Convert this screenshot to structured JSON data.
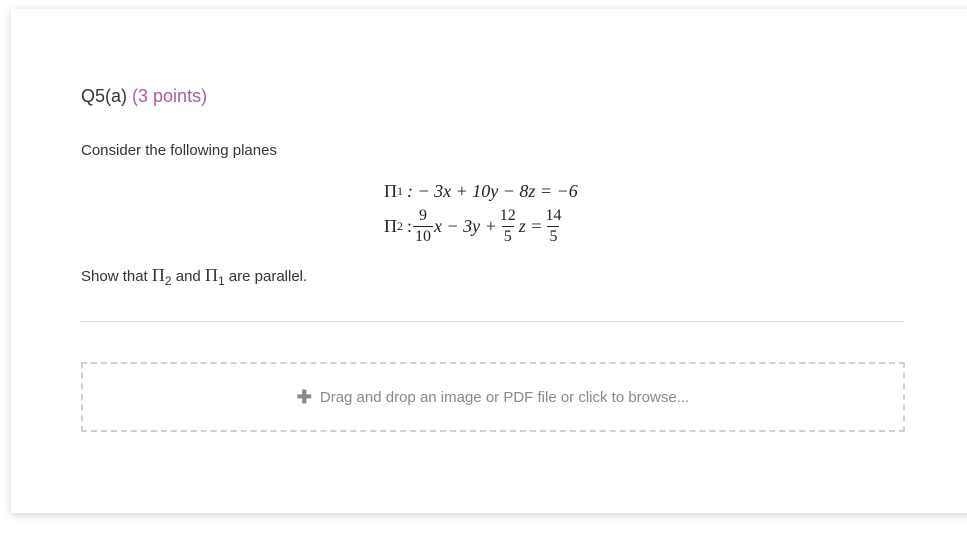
{
  "question": {
    "number": "Q5(a)",
    "points": "(3 points)"
  },
  "intro": "Consider the following planes",
  "equations": {
    "eq1": {
      "lhs": "Π",
      "lhs_sub": "1",
      "body": ": − 3x + 10y − 8z = −6"
    },
    "eq2": {
      "lhs": "Π",
      "lhs_sub": "2",
      "colon": ":",
      "f1_num": "9",
      "f1_den": "10",
      "mid": "x − 3y +",
      "f2_num": "12",
      "f2_den": "5",
      "z_eq": "z =",
      "f3_num": "14",
      "f3_den": "5"
    }
  },
  "prompt": {
    "prefix": "Show that ",
    "p2": "Π",
    "p2_sub": "2",
    "and": " and ",
    "p1": "Π",
    "p1_sub": "1",
    "suffix": " are parallel."
  },
  "upload": {
    "icon": "plus-icon",
    "label": "Drag and drop an image or PDF file or click to browse..."
  }
}
